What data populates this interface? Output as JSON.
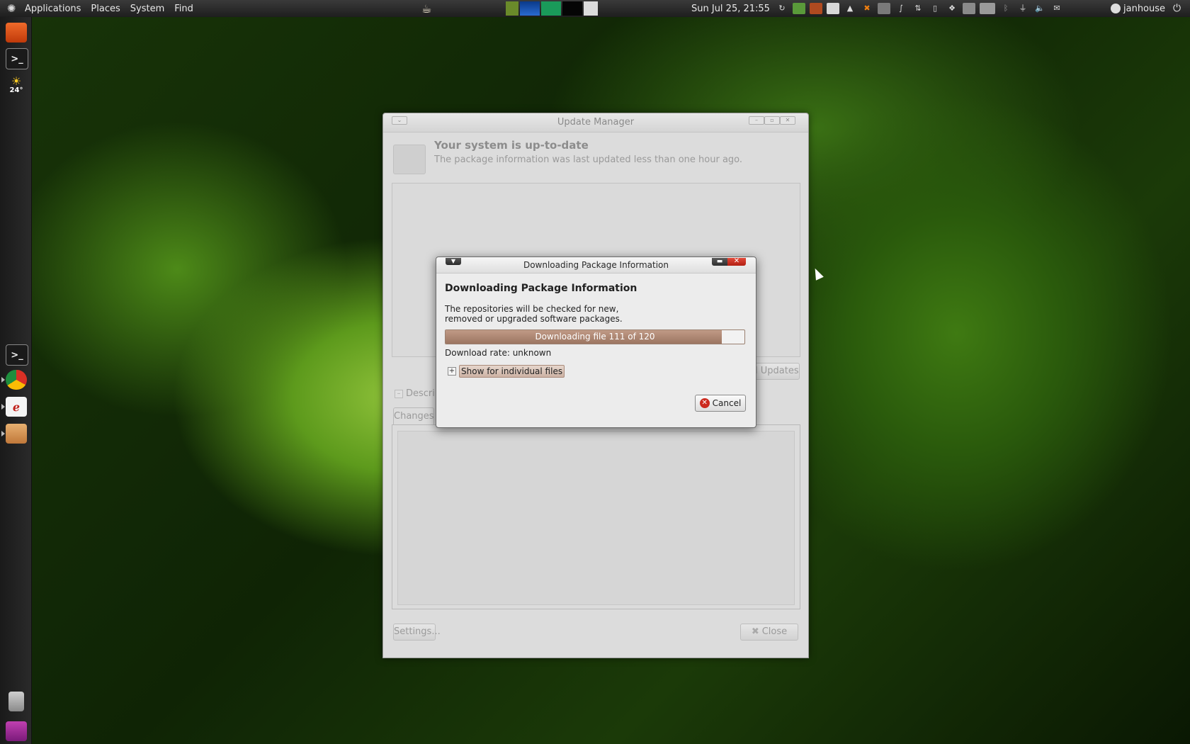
{
  "top_panel": {
    "menus": [
      "Applications",
      "Places",
      "System",
      "Find"
    ],
    "clock": "Sun Jul 25, 21:55",
    "username": "janhouse"
  },
  "dock": {
    "weather_temp": "24°"
  },
  "update_manager": {
    "title": "Update Manager",
    "status_title": "Your system is up-to-date",
    "status_subtitle": "The package information was last updated less than one hour ago.",
    "install_button": "ll Updates",
    "description_expander": "Descrip",
    "changes_tab": "Changes",
    "settings_button": "Settings...",
    "close_button": "Close"
  },
  "dialog": {
    "title": "Downloading Package Information",
    "heading": "Downloading Package Information",
    "description": "The repositories will be checked for new, removed or upgraded software packages.",
    "progress_text": "Downloading file 111 of 120",
    "progress_fraction": 0.925,
    "download_rate": "Download rate: unknown",
    "expander_label": "Show for individual files",
    "cancel_button": "Cancel"
  },
  "colors": {
    "progress_fill": "#9c7561",
    "close_red": "#cc2a1e",
    "panel_bg": "#2a2a2a"
  }
}
